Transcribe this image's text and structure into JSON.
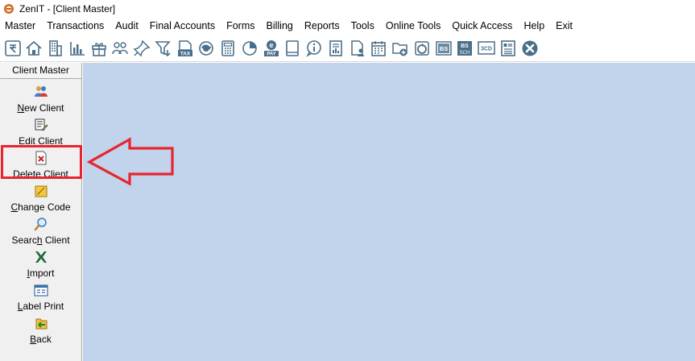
{
  "window": {
    "title": "ZenIT - [Client Master]"
  },
  "menubar": {
    "items": [
      "Master",
      "Transactions",
      "Audit",
      "Final Accounts",
      "Forms",
      "Billing",
      "Reports",
      "Tools",
      "Online Tools",
      "Quick Access",
      "Help",
      "Exit"
    ]
  },
  "toolbar": {
    "icons": [
      "rupee-ledger-icon",
      "home-icon",
      "building-icon",
      "bar-chart-icon",
      "gift-icon",
      "users-icon",
      "pin-icon",
      "filter-icon",
      "tax-icon",
      "arrow-circle-icon",
      "calculator-icon",
      "pie-chart-icon",
      "e-pay-icon",
      "book-icon",
      "info-icon",
      "report-icon",
      "user-doc-icon",
      "calendar-icon",
      "add-folder-icon",
      "refresh-icon",
      "bs-icon",
      "bs-sch-icon",
      "3cd-icon",
      "form-icon",
      "close-circle-icon"
    ],
    "labels": {
      "tax": "TAX",
      "pay": "PAY",
      "bs": "BS",
      "sch": "SCH",
      "three_cd": "3CD"
    }
  },
  "sidebar": {
    "header": "Client Master",
    "items": [
      {
        "accel": "N",
        "rest": "ew Client",
        "icon": "new-client-icon"
      },
      {
        "accel": "E",
        "rest": "dit Client",
        "icon": "edit-client-icon"
      },
      {
        "accel": "D",
        "rest": "elete Client",
        "icon": "delete-client-icon"
      },
      {
        "accel": "C",
        "rest": "hange Code",
        "icon": "change-code-icon"
      },
      {
        "pre": "Searc",
        "accel": "h",
        "rest": " Client",
        "icon": "search-client-icon"
      },
      {
        "accel": "I",
        "rest": "mport",
        "icon": "import-excel-icon"
      },
      {
        "accel": "L",
        "rest": "abel Print",
        "icon": "label-print-icon"
      },
      {
        "accel": "B",
        "rest": "ack",
        "icon": "back-icon"
      }
    ]
  },
  "colors": {
    "workarea": "#c1d4ec",
    "highlight": "#e8252e",
    "icon": "#4a6f8a"
  }
}
